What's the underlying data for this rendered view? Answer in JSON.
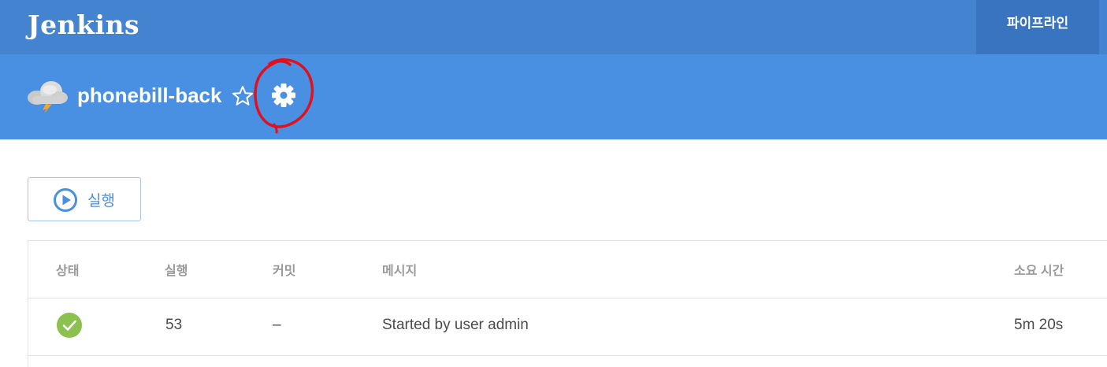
{
  "app": {
    "logo": "Jenkins",
    "nav": {
      "pipeline_label": "파이프라인"
    }
  },
  "job": {
    "name": "phonebill-back",
    "weather_icon": "cloud-lightning-icon",
    "favorite_icon": "star-outline-icon",
    "settings_icon": "gear-icon"
  },
  "actions": {
    "run_label": "실행",
    "run_icon": "play-circle-icon"
  },
  "runs_table": {
    "columns": {
      "status": "상태",
      "run": "실행",
      "commit": "커밋",
      "message": "메시지",
      "duration": "소요 시간"
    },
    "rows": [
      {
        "status": "success",
        "status_icon": "check-circle-icon",
        "run": "53",
        "commit": "–",
        "message": "Started by user admin",
        "duration": "5m 20s"
      }
    ]
  },
  "colors": {
    "topbar": "#4383cf",
    "nav_active": "#3874c0",
    "subheader": "#4a90e2",
    "success": "#8cc04f",
    "annotation": "#e3101c"
  }
}
